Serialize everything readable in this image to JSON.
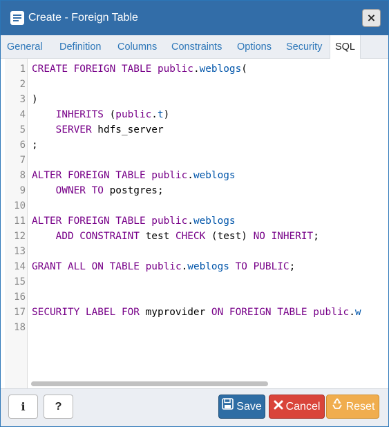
{
  "window": {
    "title": "Create - Foreign Table",
    "close_label": "×"
  },
  "tabs": [
    {
      "label": "General"
    },
    {
      "label": "Definition"
    },
    {
      "label": "Columns"
    },
    {
      "label": "Constraints"
    },
    {
      "label": "Options"
    },
    {
      "label": "Security"
    },
    {
      "label": "SQL",
      "active": true
    }
  ],
  "editor": {
    "line_numbers": [
      "1",
      "2",
      "3",
      "4",
      "5",
      "6",
      "7",
      "8",
      "9",
      "10",
      "11",
      "12",
      "13",
      "14",
      "15",
      "16",
      "17",
      "18"
    ],
    "lines": [
      [
        {
          "t": "CREATE FOREIGN TABLE ",
          "c": "kw"
        },
        {
          "t": "public",
          "c": "kw"
        },
        {
          "t": ".",
          "c": ""
        },
        {
          "t": "weblogs",
          "c": "prop"
        },
        {
          "t": "(",
          "c": ""
        }
      ],
      [],
      [
        {
          "t": ")",
          "c": ""
        }
      ],
      [
        {
          "t": "    ",
          "c": ""
        },
        {
          "t": "INHERITS",
          "c": "kw"
        },
        {
          "t": " (",
          "c": ""
        },
        {
          "t": "public",
          "c": "kw"
        },
        {
          "t": ".",
          "c": ""
        },
        {
          "t": "t",
          "c": "prop"
        },
        {
          "t": ")",
          "c": ""
        }
      ],
      [
        {
          "t": "    ",
          "c": ""
        },
        {
          "t": "SERVER",
          "c": "kw"
        },
        {
          "t": " hdfs_server",
          "c": ""
        }
      ],
      [
        {
          "t": ";",
          "c": ""
        }
      ],
      [],
      [
        {
          "t": "ALTER FOREIGN TABLE ",
          "c": "kw"
        },
        {
          "t": "public",
          "c": "kw"
        },
        {
          "t": ".",
          "c": ""
        },
        {
          "t": "weblogs",
          "c": "prop"
        }
      ],
      [
        {
          "t": "    ",
          "c": ""
        },
        {
          "t": "OWNER TO",
          "c": "kw"
        },
        {
          "t": " postgres;",
          "c": ""
        }
      ],
      [],
      [
        {
          "t": "ALTER FOREIGN TABLE ",
          "c": "kw"
        },
        {
          "t": "public",
          "c": "kw"
        },
        {
          "t": ".",
          "c": ""
        },
        {
          "t": "weblogs",
          "c": "prop"
        }
      ],
      [
        {
          "t": "    ",
          "c": ""
        },
        {
          "t": "ADD CONSTRAINT",
          "c": "kw"
        },
        {
          "t": " test ",
          "c": ""
        },
        {
          "t": "CHECK",
          "c": "kw"
        },
        {
          "t": " (test) ",
          "c": ""
        },
        {
          "t": "NO INHERIT",
          "c": "kw"
        },
        {
          "t": ";",
          "c": ""
        }
      ],
      [],
      [
        {
          "t": "GRANT ALL ON TABLE ",
          "c": "kw"
        },
        {
          "t": "public",
          "c": "kw"
        },
        {
          "t": ".",
          "c": ""
        },
        {
          "t": "weblogs",
          "c": "prop"
        },
        {
          "t": " ",
          "c": ""
        },
        {
          "t": "TO PUBLIC",
          "c": "kw"
        },
        {
          "t": ";",
          "c": ""
        }
      ],
      [],
      [],
      [
        {
          "t": "SECURITY LABEL FOR",
          "c": "kw"
        },
        {
          "t": " myprovider ",
          "c": ""
        },
        {
          "t": "ON FOREIGN TABLE ",
          "c": "kw"
        },
        {
          "t": "public",
          "c": "kw"
        },
        {
          "t": ".",
          "c": ""
        },
        {
          "t": "w",
          "c": "prop"
        }
      ],
      []
    ]
  },
  "footer": {
    "info_label": "i",
    "help_label": "?",
    "save_label": "Save",
    "cancel_label": "Cancel",
    "reset_label": "Reset"
  },
  "colors": {
    "title_bar": "#326da8",
    "keyword": "#770088",
    "property": "#0055aa",
    "save": "#2e6da4",
    "cancel": "#d9443a",
    "reset": "#f0ad4e"
  }
}
